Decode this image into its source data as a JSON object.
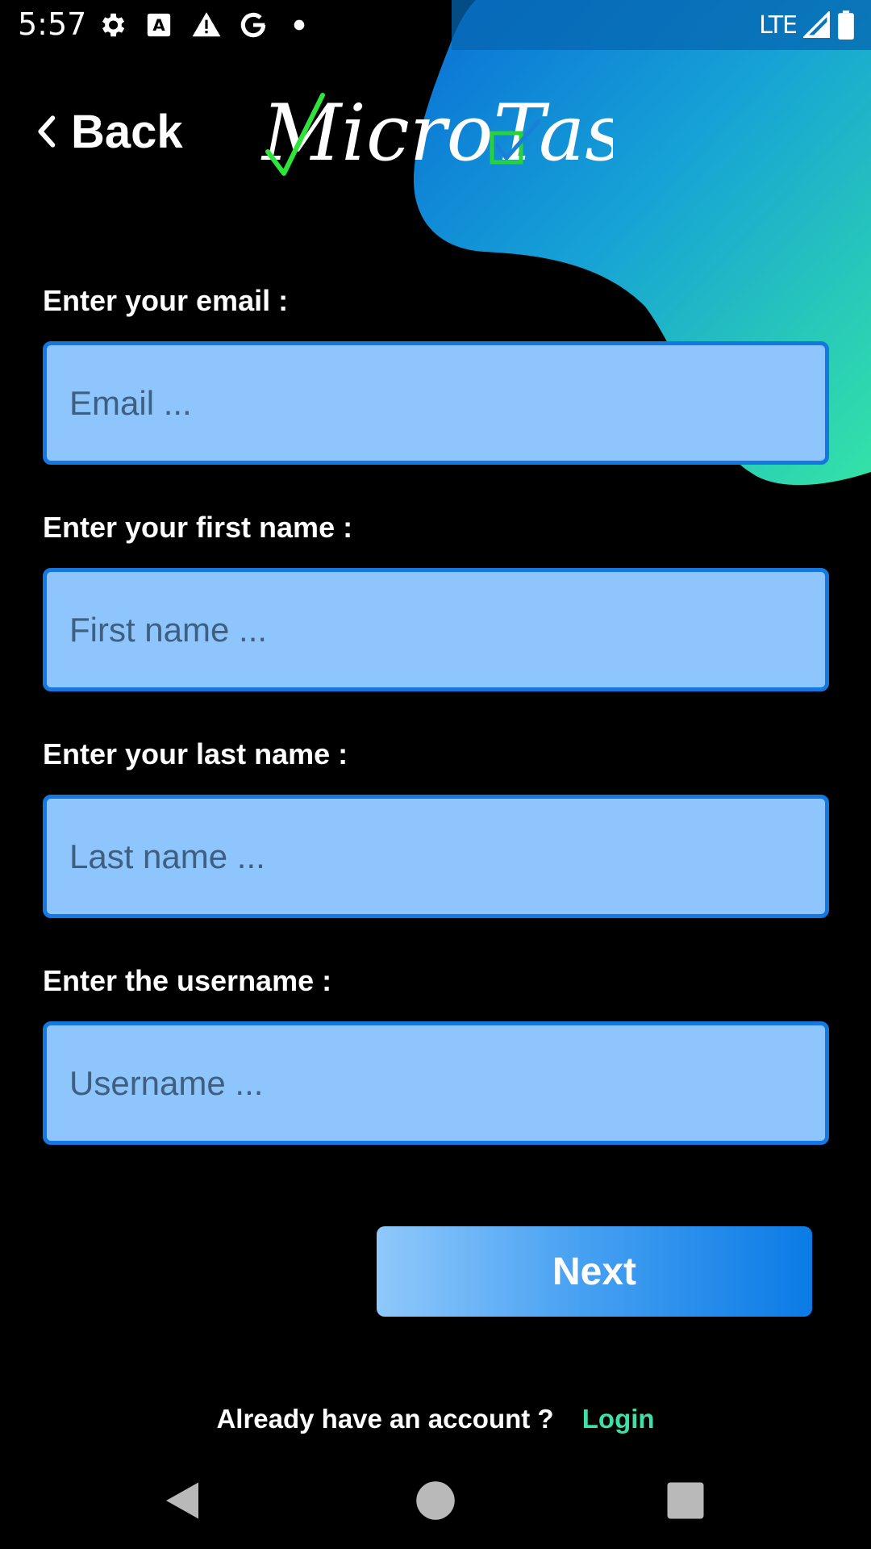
{
  "status_bar": {
    "time": "5:57",
    "network": "LTE",
    "icons": [
      "settings-icon",
      "text-recognition-icon",
      "warning-icon",
      "google-icon",
      "dot-icon",
      "signal-icon",
      "battery-icon"
    ]
  },
  "header": {
    "back_label": "Back",
    "logo_text": "MicroTask"
  },
  "form": {
    "email": {
      "label": "Enter your email :",
      "placeholder": "Email ...",
      "value": ""
    },
    "first_name": {
      "label": "Enter your first name :",
      "placeholder": "First name ...",
      "value": ""
    },
    "last_name": {
      "label": "Enter your last name :",
      "placeholder": "Last name ...",
      "value": ""
    },
    "username": {
      "label": "Enter the username :",
      "placeholder": "Username ...",
      "value": ""
    },
    "next_label": "Next"
  },
  "footer": {
    "question": "Already have an account ?",
    "login_label": "Login"
  },
  "nav_bar": {
    "icons": [
      "back-triangle-icon",
      "home-circle-icon",
      "recents-square-icon"
    ]
  },
  "colors": {
    "background": "#000000",
    "input_fill": "#8ec5fc",
    "input_border": "#1478e0",
    "login_link": "#3ee0a8",
    "button_gradient_start": "#90c8fb",
    "button_gradient_end": "#0a7be6"
  }
}
